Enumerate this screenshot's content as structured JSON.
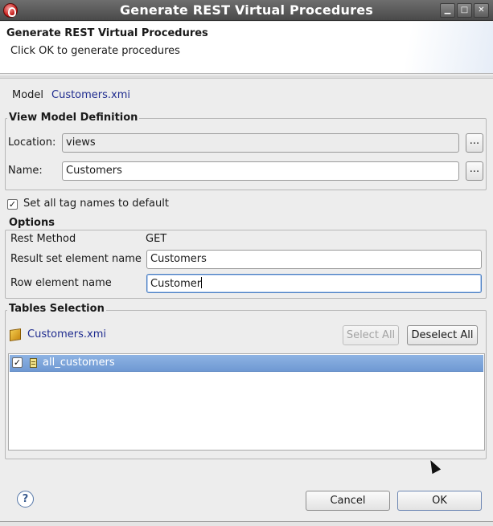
{
  "window": {
    "title": "Generate REST Virtual Procedures",
    "minimize_glyph": "▁",
    "maximize_glyph": "□",
    "close_glyph": "✕"
  },
  "banner": {
    "title": "Generate REST Virtual Procedures",
    "description": "Click OK to generate procedures"
  },
  "model": {
    "label": "Model",
    "value": "Customers.xmi"
  },
  "view_model_definition": {
    "title": "View Model Definition",
    "location_label": "Location:",
    "location_value": "views",
    "name_label": "Name:",
    "name_value": "Customers",
    "browse_label": "..."
  },
  "tag_names": {
    "checked": true,
    "check_glyph": "✓",
    "label": "Set all tag names to default"
  },
  "options": {
    "title": "Options",
    "rest_method_label": "Rest Method",
    "rest_method_value": "GET",
    "result_set_label": "Result set element name",
    "result_set_value": "Customers",
    "row_element_label": "Row element name",
    "row_element_value": "Customer"
  },
  "tables_selection": {
    "title": "Tables Selection",
    "source": "Customers.xmi",
    "select_all_label": "Select All",
    "deselect_all_label": "Deselect All",
    "items": [
      {
        "label": "all_customers",
        "checked": true
      }
    ]
  },
  "footer": {
    "help_glyph": "?",
    "cancel_label": "Cancel",
    "ok_label": "OK"
  },
  "icons": {
    "app": "jboss-app-icon",
    "help": "help-icon",
    "package": "model-package-icon",
    "table": "table-icon"
  }
}
